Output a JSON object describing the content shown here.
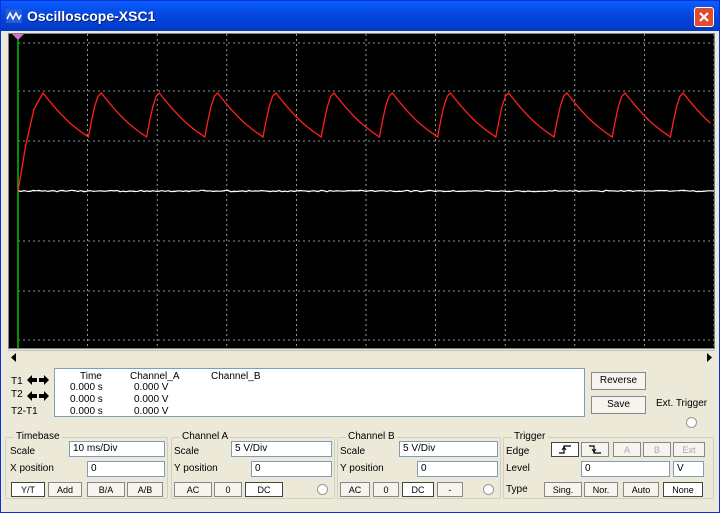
{
  "window": {
    "title": "Oscilloscope-XSC1"
  },
  "colors": {
    "channel_a_trace": "#FF2020",
    "channel_b_trace": "#FFFFFF",
    "grid": "#BFBFBF",
    "screen_bg": "#000000",
    "cursor": "#00C000"
  },
  "readout": {
    "headers": {
      "time": "Time",
      "a": "Channel_A",
      "b": "Channel_B"
    },
    "rows": [
      {
        "label": "T1",
        "time": "0.000 s",
        "a": "0.000 V"
      },
      {
        "label": "T2",
        "time": "0.000 s",
        "a": "0.000 V"
      },
      {
        "label": "T2-T1",
        "time": "0.000 s",
        "a": "0.000 V"
      }
    ]
  },
  "side": {
    "reverse": "Reverse",
    "save": "Save",
    "ext_trigger": "Ext. Trigger"
  },
  "timebase": {
    "title": "Timebase",
    "scale_label": "Scale",
    "scale": "10 ms/Div",
    "xpos_label": "X position",
    "xpos": "0",
    "buttons": [
      "Y/T",
      "Add",
      "B/A",
      "A/B"
    ]
  },
  "channel_a": {
    "title": "Channel A",
    "scale_label": "Scale",
    "scale": "5  V/Div",
    "ypos_label": "Y position",
    "ypos": "0",
    "buttons": [
      "AC",
      "0",
      "DC"
    ]
  },
  "channel_b": {
    "title": "Channel B",
    "scale_label": "Scale",
    "scale": "5  V/Div",
    "ypos_label": "Y position",
    "ypos": "0",
    "buttons": [
      "AC",
      "0",
      "DC",
      "-"
    ]
  },
  "trigger": {
    "title": "Trigger",
    "edge_label": "Edge",
    "level_label": "Level",
    "level": "0",
    "unit": "V",
    "type_label": "Type",
    "source_buttons": [
      "A",
      "B",
      "Ext"
    ],
    "type_buttons": [
      "Sing.",
      "Nor.",
      "Auto",
      "None"
    ]
  }
}
